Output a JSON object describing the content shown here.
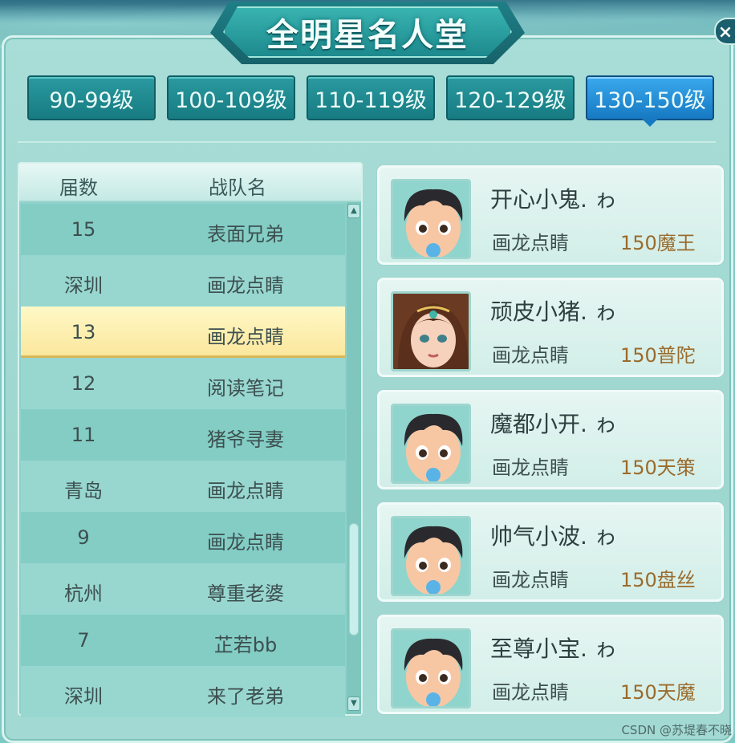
{
  "window": {
    "title": "全明星名人堂",
    "close_label": "×"
  },
  "tabs": [
    {
      "label": "90-99级",
      "active": false
    },
    {
      "label": "100-109级",
      "active": false
    },
    {
      "label": "110-119级",
      "active": false
    },
    {
      "label": "120-129级",
      "active": false
    },
    {
      "label": "130-150级",
      "active": true
    }
  ],
  "table": {
    "headers": {
      "session": "届数",
      "team": "战队名"
    },
    "rows": [
      {
        "session": "15",
        "team": "表面兄弟"
      },
      {
        "session": "深圳",
        "team": "画龙点睛"
      },
      {
        "session": "13",
        "team": "画龙点睛",
        "selected": true
      },
      {
        "session": "12",
        "team": "阅读笔记"
      },
      {
        "session": "11",
        "team": "猪爷寻妻"
      },
      {
        "session": "青岛",
        "team": "画龙点睛"
      },
      {
        "session": "9",
        "team": "画龙点睛"
      },
      {
        "session": "杭州",
        "team": "尊重老婆"
      },
      {
        "session": "7",
        "team": "芷若bb"
      },
      {
        "session": "深圳",
        "team": "来了老弟"
      }
    ]
  },
  "members": [
    {
      "name": "开心小鬼. ゎ",
      "team": "画龙点睛",
      "level_school": "150魔王",
      "avatar": "boy-avatar"
    },
    {
      "name": "顽皮小猪. ゎ",
      "team": "画龙点睛",
      "level_school": "150普陀",
      "avatar": "girl-avatar"
    },
    {
      "name": "魔都小开. ゎ",
      "team": "画龙点睛",
      "level_school": "150天策",
      "avatar": "boy-avatar"
    },
    {
      "name": "帅气小波. ゎ",
      "team": "画龙点睛",
      "level_school": "150盘丝",
      "avatar": "boy-avatar"
    },
    {
      "name": "至尊小宝. ゎ",
      "team": "画龙点睛",
      "level_school": "150天魔",
      "avatar": "boy-avatar"
    }
  ],
  "watermark": "CSDN @苏堤春不晓",
  "colors": {
    "tab_active": "#1679c2",
    "tab_normal": "#177b82",
    "row_selected": "#fbe79e",
    "level_text": "#9a6b2c"
  }
}
